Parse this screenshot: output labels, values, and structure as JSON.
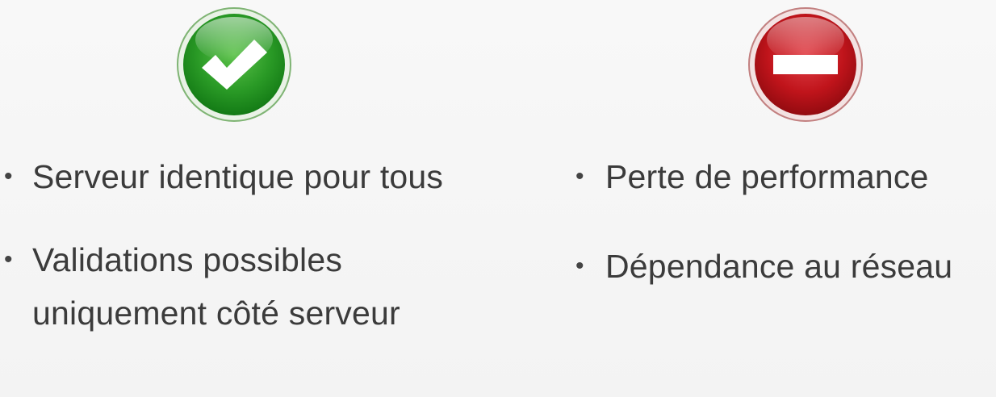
{
  "pros": {
    "icon": "green-checkmark-icon",
    "color": "#2f9a2a",
    "items": [
      {
        "label": "Serveur identique pour tous"
      },
      {
        "label": "Validations possibles uniquement côté serveur"
      }
    ]
  },
  "cons": {
    "icon": "red-minus-icon",
    "color": "#c0141b",
    "items": [
      {
        "label": "Perte de performance"
      },
      {
        "label": "Dépendance au réseau"
      }
    ]
  }
}
